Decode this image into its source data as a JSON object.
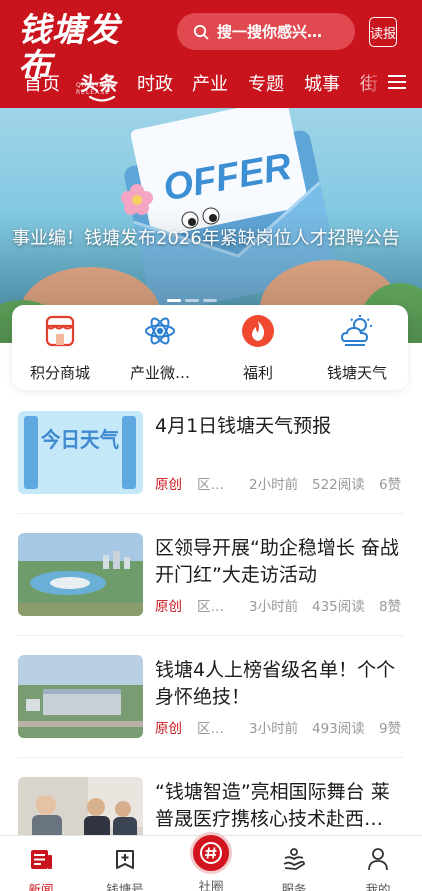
{
  "header": {
    "logo_text": "钱塘发布",
    "logo_sub": "QIANTANG RELEASE",
    "search_placeholder": "搜一搜你感兴…",
    "read_label": "读报",
    "tabs": [
      "首页",
      "头条",
      "时政",
      "产业",
      "专题",
      "城事",
      "街"
    ],
    "active_tab": "头条",
    "colors": {
      "brand": "#c9141d",
      "search_bg": "#e04950"
    }
  },
  "banner": {
    "title": "事业编！钱塘发布2026年紧缺岗位人才招聘公告",
    "image_text": "OFFER",
    "slides": 3,
    "active_slide": 1
  },
  "quick_entries": [
    {
      "label": "积分商城",
      "icon": "shop-icon"
    },
    {
      "label": "产业微…",
      "icon": "atom-icon"
    },
    {
      "label": "福利",
      "icon": "flame-icon"
    },
    {
      "label": "钱塘天气",
      "icon": "weather-icon"
    }
  ],
  "news": [
    {
      "title": "4月1日钱塘天气预报",
      "tag": "原创",
      "source": "区…",
      "time": "2小时前",
      "reads": "522阅读",
      "likes": "6赞",
      "thumb_text": "今日天气"
    },
    {
      "title": "区领导开展“助企稳增长 奋战开门红”大走访活动",
      "tag": "原创",
      "source": "区…",
      "time": "3小时前",
      "reads": "435阅读",
      "likes": "8赞"
    },
    {
      "title": "钱塘4人上榜省级名单！个个身怀绝技！",
      "tag": "原创",
      "source": "区…",
      "time": "3小时前",
      "reads": "493阅读",
      "likes": "9赞"
    },
    {
      "title": "“钱塘智造”亮相国际舞台 莱普晟医疗携核心技术赴西…"
    }
  ],
  "bottom_nav": [
    {
      "label": "新闻",
      "icon": "news-icon",
      "active": true
    },
    {
      "label": "钱塘号",
      "icon": "add-square-icon",
      "active": false
    },
    {
      "label": "社圈",
      "icon": "hashtag-icon",
      "active": false
    },
    {
      "label": "服务",
      "icon": "service-hand-icon",
      "active": false
    },
    {
      "label": "我的",
      "icon": "person-icon",
      "active": false
    }
  ]
}
